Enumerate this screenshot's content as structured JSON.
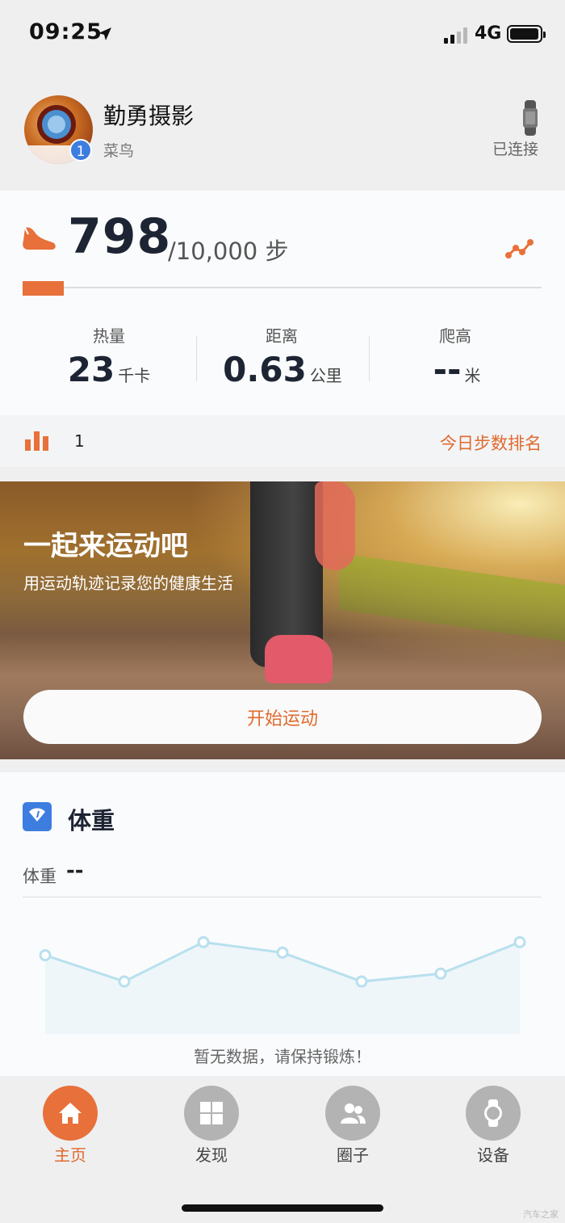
{
  "status": {
    "time": "09:25",
    "network": "4G"
  },
  "profile": {
    "name": "勤勇摄影",
    "level": "菜鸟",
    "badge": "1",
    "device_status": "已连接"
  },
  "steps": {
    "value": "798",
    "goal": "/10,000 步",
    "progress_fraction": 0.08
  },
  "stats": [
    {
      "label": "热量",
      "value": "23",
      "unit": "千卡"
    },
    {
      "label": "距离",
      "value": "0.63",
      "unit": "公里"
    },
    {
      "label": "爬高",
      "value": "--",
      "unit": "米"
    }
  ],
  "rank": {
    "value": "1",
    "link": "今日步数排名"
  },
  "banner": {
    "title": "一起来运动吧",
    "subtitle": "用运动轨迹记录您的健康生活",
    "button": "开始运动"
  },
  "weight": {
    "title": "体重",
    "label": "体重",
    "value": "--",
    "empty_message": "暂无数据，请保持锻炼！",
    "chart_placeholder": [
      60,
      40,
      70,
      62,
      40,
      46,
      70
    ]
  },
  "tabs": [
    {
      "label": "主页",
      "icon": "home-icon",
      "active": true
    },
    {
      "label": "发现",
      "icon": "grid-icon",
      "active": false
    },
    {
      "label": "圈子",
      "icon": "people-icon",
      "active": false
    },
    {
      "label": "设备",
      "icon": "watch-icon",
      "active": false
    }
  ],
  "watermark": "汽车之家",
  "colors": {
    "accent": "#e8703a",
    "accent_text": "#e06a2e",
    "weight_icon": "#3d7de0",
    "chart_line": "#b8e0ee"
  }
}
